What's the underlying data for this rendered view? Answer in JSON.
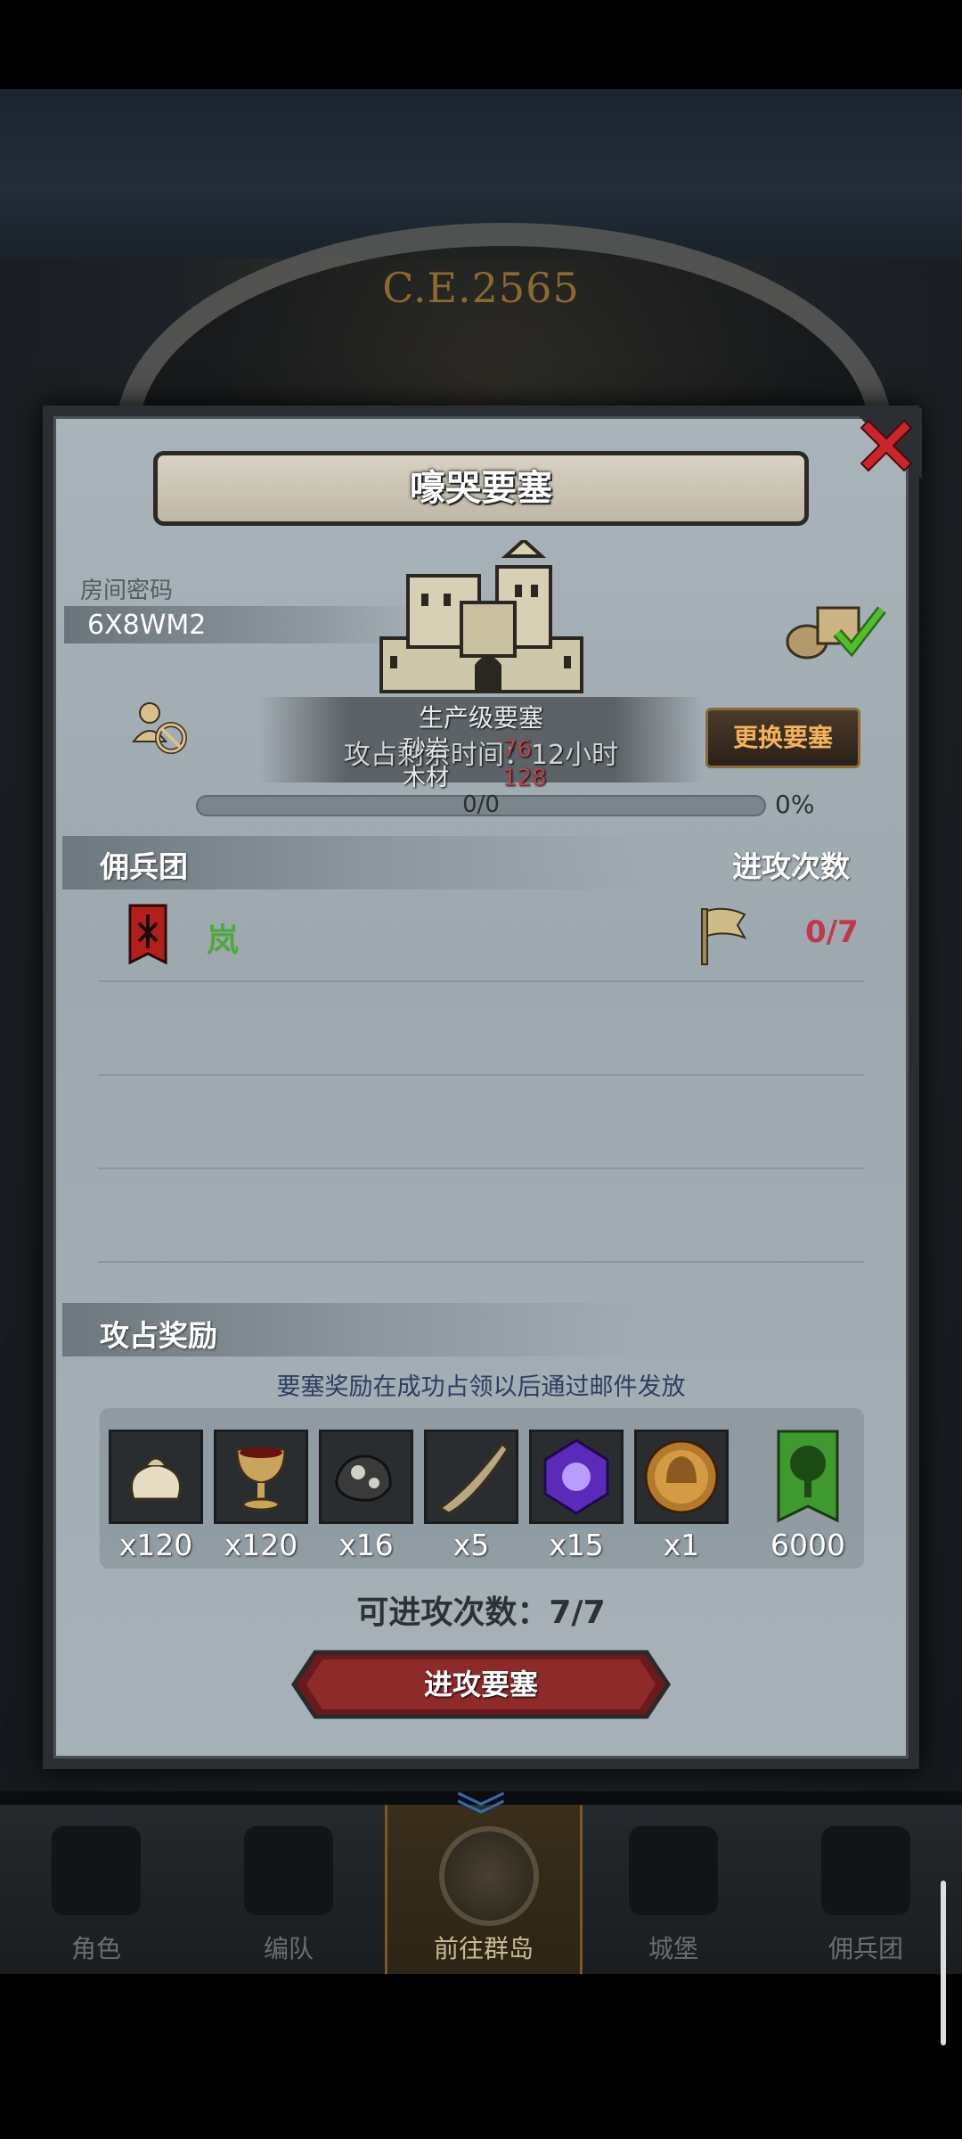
{
  "background": {
    "era_label": "C.E.2565"
  },
  "dialog": {
    "title": "嚎哭要塞",
    "room_code_label": "房间密码",
    "room_code": "6X8WM2",
    "fortress_line1": "生产级要塞",
    "fortress_line2": "攻占剩余时间：12小时",
    "resources": [
      {
        "label": "砂岩",
        "value": "76"
      },
      {
        "label": "木材",
        "value": "128"
      }
    ],
    "change_button": "更换要塞",
    "progress_text": "0/0",
    "progress_percent": "0%",
    "mercenary_header": "佣兵团",
    "attack_count_header": "进攻次数",
    "guild": {
      "name": "岚",
      "attack_count": "0/7"
    },
    "reward_header": "攻占奖励",
    "reward_note": "要塞奖励在成功占领以后通过邮件发放",
    "rewards": [
      {
        "icon": "sack-icon",
        "qty": "x120"
      },
      {
        "icon": "goblet-icon",
        "qty": "x120"
      },
      {
        "icon": "ore-icon",
        "qty": "x16"
      },
      {
        "icon": "horn-icon",
        "qty": "x5"
      },
      {
        "icon": "purple-gem-icon",
        "qty": "x15"
      },
      {
        "icon": "helmet-coin-icon",
        "qty": "x1"
      },
      {
        "icon": "tree-banner-icon",
        "qty": "6000"
      }
    ],
    "attempts_text": "可进攻次数：7/7",
    "attack_button": "进攻要塞"
  },
  "bottom_nav": [
    {
      "label": "角色"
    },
    {
      "label": "编队"
    },
    {
      "label": "前往群岛",
      "active": true
    },
    {
      "label": "城堡"
    },
    {
      "label": "佣兵团"
    }
  ],
  "colors": {
    "guild_name": "#4fa83e",
    "attack_count": "#c0384a",
    "change_button_text": "#f4b25a",
    "reward_note": "#2d3e63"
  }
}
